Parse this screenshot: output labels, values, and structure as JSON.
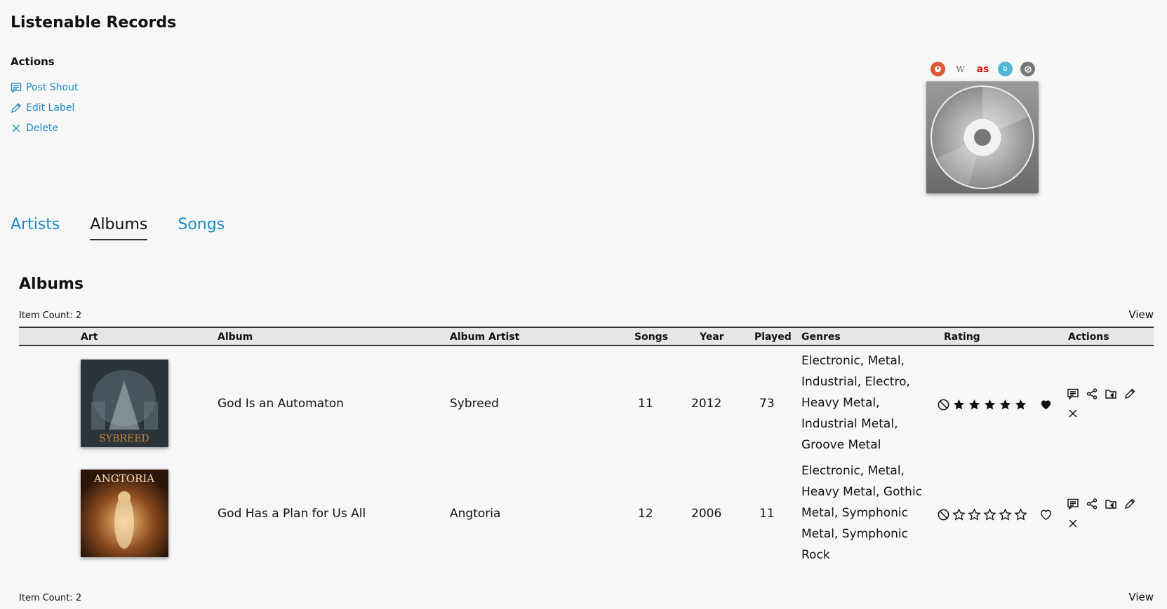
{
  "page": {
    "title": "Listenable Records"
  },
  "actions": {
    "heading": "Actions",
    "post_shout": "Post Shout",
    "edit_label": "Edit Label",
    "delete": "Delete"
  },
  "external_links": [
    {
      "name": "duckduckgo",
      "glyph": "",
      "color": "#de5833"
    },
    {
      "name": "wikipedia",
      "glyph": "W",
      "color": "#666666"
    },
    {
      "name": "lastfm",
      "glyph": "as",
      "color": "#d51007"
    },
    {
      "name": "bandcamp",
      "glyph": "b",
      "color": "#4fb6d3"
    },
    {
      "name": "musicbrainz",
      "glyph": "",
      "color": "#777777"
    }
  ],
  "tabs": [
    {
      "label": "Artists",
      "active": false
    },
    {
      "label": "Albums",
      "active": true
    },
    {
      "label": "Songs",
      "active": false
    }
  ],
  "albums": {
    "title": "Albums",
    "item_count": "Item Count: 2",
    "view_label": "View",
    "columns": [
      "Art",
      "Album",
      "Album Artist",
      "Songs",
      "Year",
      "Played",
      "Genres",
      "Rating",
      "Actions"
    ],
    "rows": [
      {
        "album": "God Is an Automaton",
        "artist": "Sybreed",
        "songs": "11",
        "year": "2012",
        "played": "73",
        "genres": "Electronic, Metal, Industrial, Electro, Heavy Metal, Industrial Metal, Groove Metal",
        "rating": 5,
        "favorite": true,
        "art_text": "SYBREED"
      },
      {
        "album": "God Has a Plan for Us All",
        "artist": "Angtoria",
        "songs": "12",
        "year": "2006",
        "played": "11",
        "genres": "Electronic, Metal, Heavy Metal, Gothic Metal, Symphonic Metal, Symphonic Rock",
        "rating": 0,
        "favorite": false,
        "art_text": "ANGTORIA"
      }
    ]
  },
  "colors": {
    "link": "#1a8ac4",
    "header_bg": "#e6e6e6",
    "background": "#f7f7f7"
  }
}
